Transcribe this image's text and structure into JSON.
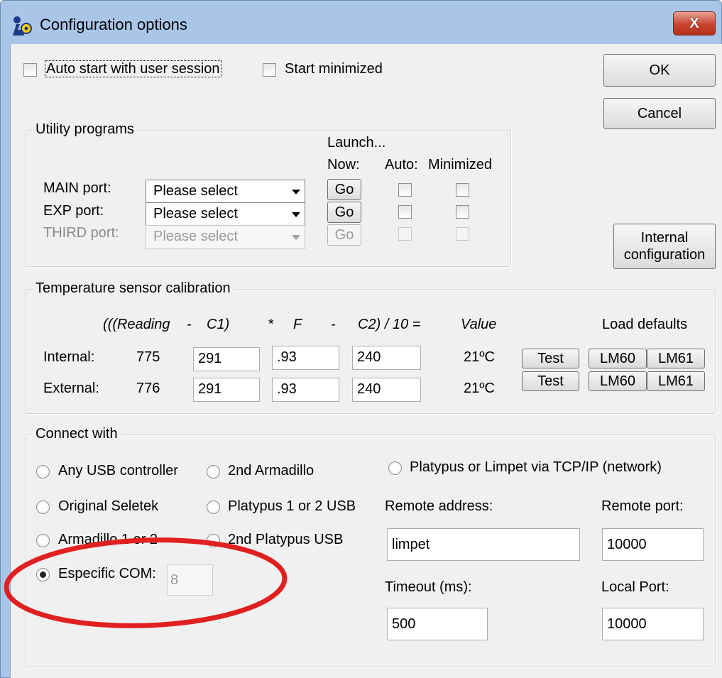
{
  "window": {
    "title": "Configuration options",
    "close_label": "X"
  },
  "colors": {
    "accent_red": "#e02020",
    "titlebar": "#a9c6e8"
  },
  "top": {
    "auto_start_label": "Auto start with user session",
    "start_minimized_label": "Start minimized",
    "ok_label": "OK",
    "cancel_label": "Cancel",
    "internal_config_label_line1": "Internal",
    "internal_config_label_line2": "configuration"
  },
  "utility": {
    "legend": "Utility programs",
    "launch_header": "Launch...",
    "now_header": "Now:",
    "auto_header": "Auto:",
    "minimized_header": "Minimized",
    "go_label": "Go",
    "ports": [
      {
        "label": "MAIN port:",
        "value": "Please select"
      },
      {
        "label": "EXP port:",
        "value": "Please select"
      },
      {
        "label": "THIRD port:",
        "value": "Please select"
      }
    ]
  },
  "temperature": {
    "legend": "Temperature sensor calibration",
    "formula": {
      "t1": "(((Reading",
      "t2": "-",
      "t3": "C1)",
      "t4": "*",
      "t5": "F",
      "t6": "-",
      "t7": "C2) / 10 =",
      "t8": "Value"
    },
    "load_defaults": "Load defaults",
    "test_label": "Test",
    "lm60_label": "LM60",
    "lm61_label": "LM61",
    "rows": [
      {
        "label": "Internal:",
        "reading": "775",
        "c1": "291",
        "f": ".93",
        "c2": "240",
        "value": "21ºC"
      },
      {
        "label": "External:",
        "reading": "776",
        "c1": "291",
        "f": ".93",
        "c2": "240",
        "value": "21ºC"
      }
    ]
  },
  "connect": {
    "legend": "Connect with",
    "any_usb": "Any USB controller",
    "second_armadillo": "2nd Armadillo",
    "platypus_tcp": "Platypus or Limpet via TCP/IP (network)",
    "original_seletek": "Original Seletek",
    "platypus_1_2_usb": "Platypus 1 or 2 USB",
    "armadillo_1_2": "Armadillo 1 or 2",
    "second_platypus_usb": "2nd Platypus USB",
    "especific_com": "Especific COM:",
    "com_value": "8",
    "remote_address_label": "Remote address:",
    "remote_address_value": "limpet",
    "remote_port_label": "Remote port:",
    "remote_port_value": "10000",
    "timeout_label": "Timeout (ms):",
    "timeout_value": "500",
    "local_port_label": "Local Port:",
    "local_port_value": "10000"
  }
}
